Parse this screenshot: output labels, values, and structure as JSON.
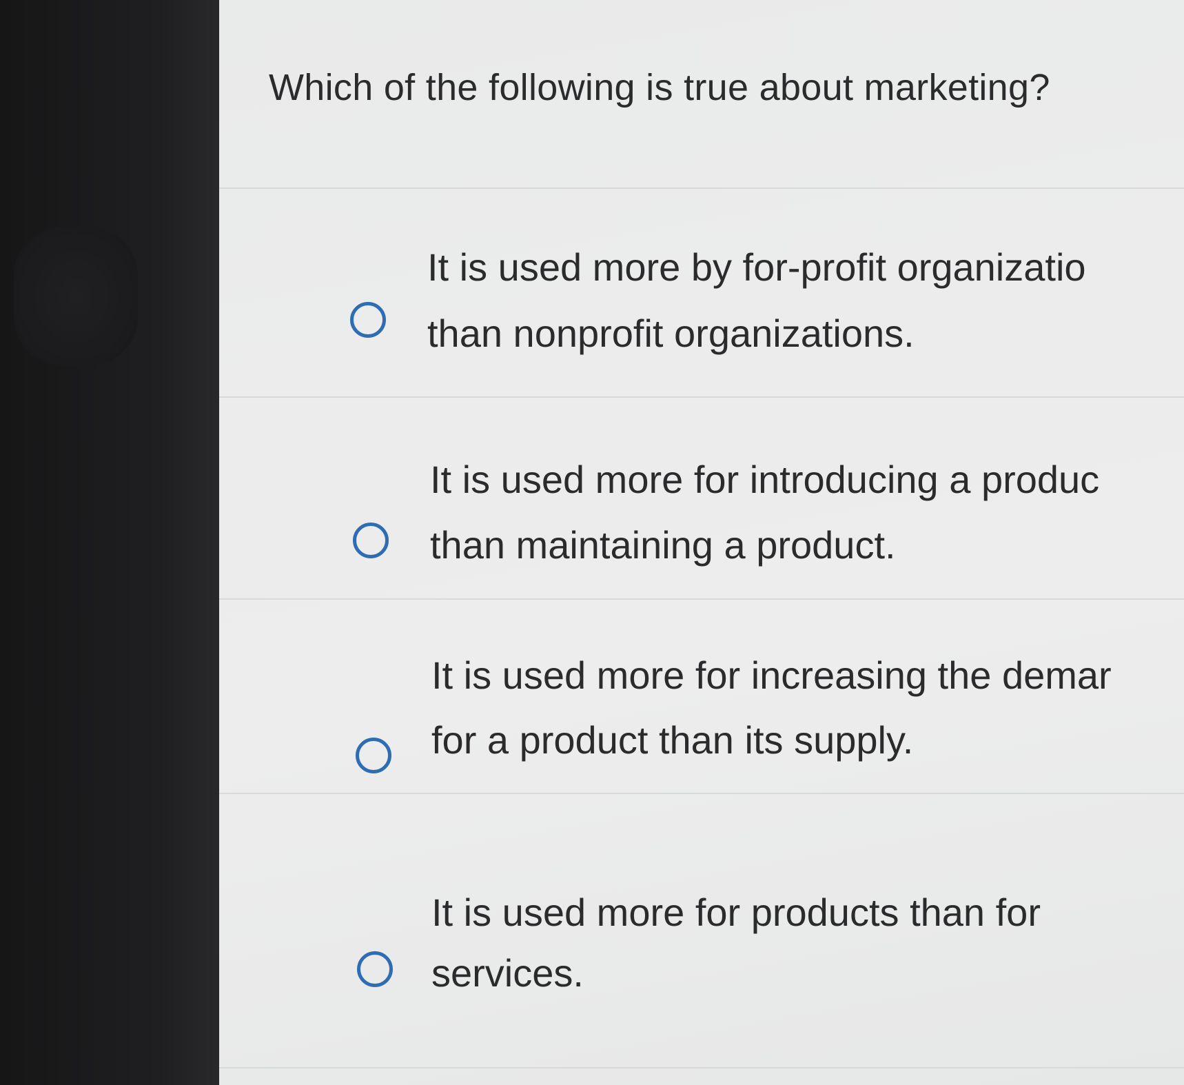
{
  "question": {
    "text": "Which of the following is true about marketing?"
  },
  "options": [
    {
      "line1": "It is used more by for-profit organizatio",
      "line2": "than nonprofit organizations."
    },
    {
      "line1": "It is used more for introducing a produc",
      "line2": "than maintaining a product."
    },
    {
      "line1": "It is used more for increasing the demar",
      "line2": "for a product than its supply."
    },
    {
      "line1": "It is used more for products than for",
      "line2": "services."
    }
  ],
  "colors": {
    "radio_border": "#2f6db3",
    "text": "#2b2b2d",
    "background": "#ececec"
  }
}
